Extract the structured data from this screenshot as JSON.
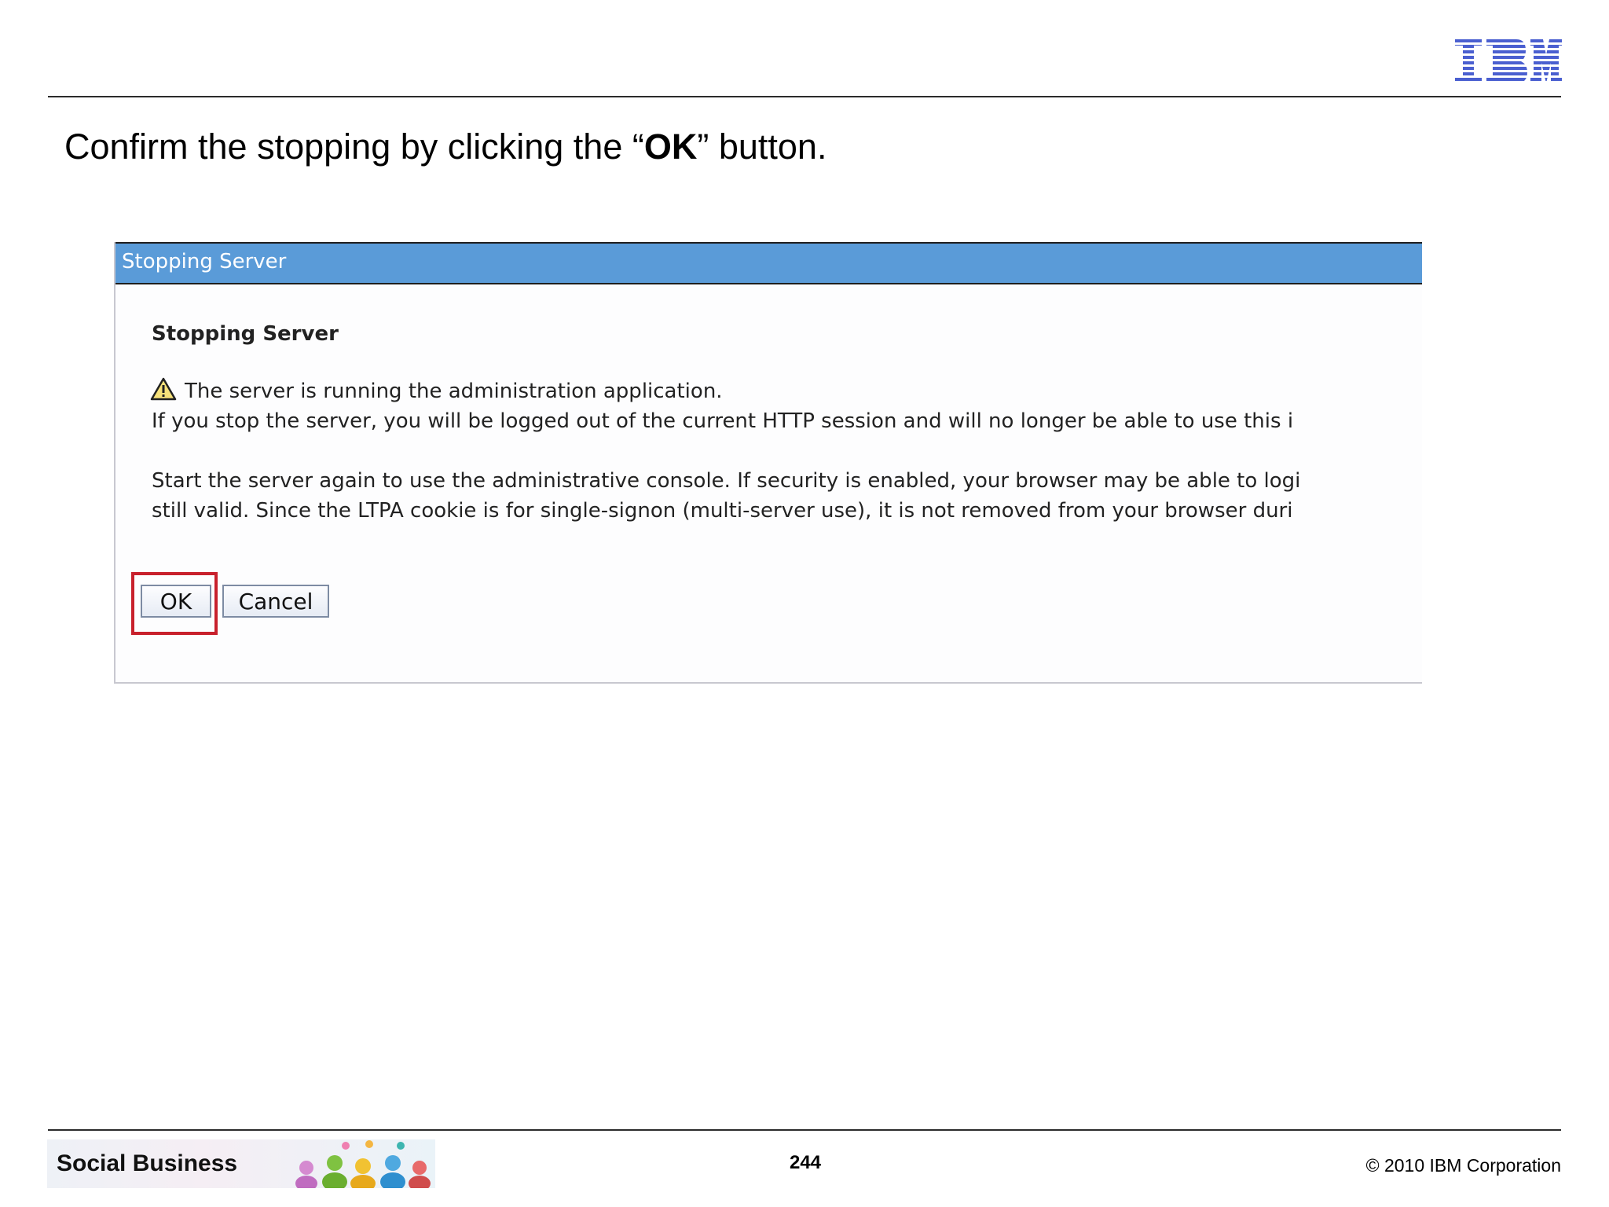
{
  "header": {
    "logo_text": "IBM",
    "logo_color": "#4a5fd0",
    "instruction": {
      "before": "Confirm the stopping by clicking the “",
      "emphasis": "OK",
      "after": "” button."
    }
  },
  "dialog": {
    "title": "Stopping Server",
    "heading": "Stopping Server",
    "warning_icon": "warning-triangle-icon",
    "lines": [
      "The server is running the administration application.",
      "If you stop the server, you will be logged out of the current HTTP session and will no longer be able to use this i",
      "Start the server again to use the administrative console. If security is enabled, your browser may be able to logi",
      "still valid. Since the LTPA cookie is for single-signon (multi-server use), it is not removed from your browser duri"
    ],
    "ok_label": "OK",
    "cancel_label": "Cancel",
    "titlebar_color": "#5a9bd8",
    "highlight_color": "#c8202c"
  },
  "footer": {
    "brand": "Social Business",
    "page_number": "244",
    "copyright": "© 2010 IBM Corporation"
  }
}
